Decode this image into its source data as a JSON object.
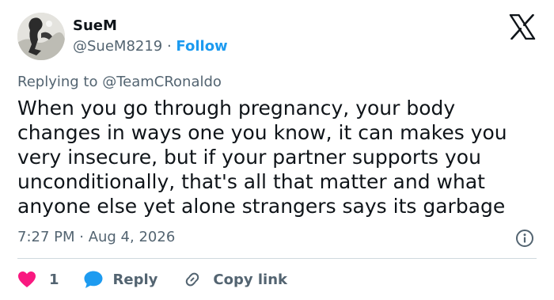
{
  "user": {
    "display_name": "SueM",
    "handle": "@SueM8219",
    "separator": " · ",
    "follow_label": "Follow"
  },
  "logo": {
    "icon": "x-logo-icon"
  },
  "reply_context": {
    "prefix": "Replying to ",
    "mention": "@TeamCRonaldo"
  },
  "tweet": {
    "lines": [
      "When you go through pregnancy, your body",
      "changes in ways one you know, it can makes you",
      "very insecure, but if your partner supports you",
      "unconditionally, that's all that matter and what",
      "anyone else yet alone strangers says its garbage"
    ],
    "timestamp": "7:27 PM · Aug 4, 2026"
  },
  "actions": {
    "like_count": "1",
    "reply_label": "Reply",
    "copy_link_label": "Copy link"
  },
  "colors": {
    "accent": "#1d9bf0",
    "like": "#f91880",
    "secondary_text": "#536471",
    "primary_text": "#0f1419"
  }
}
